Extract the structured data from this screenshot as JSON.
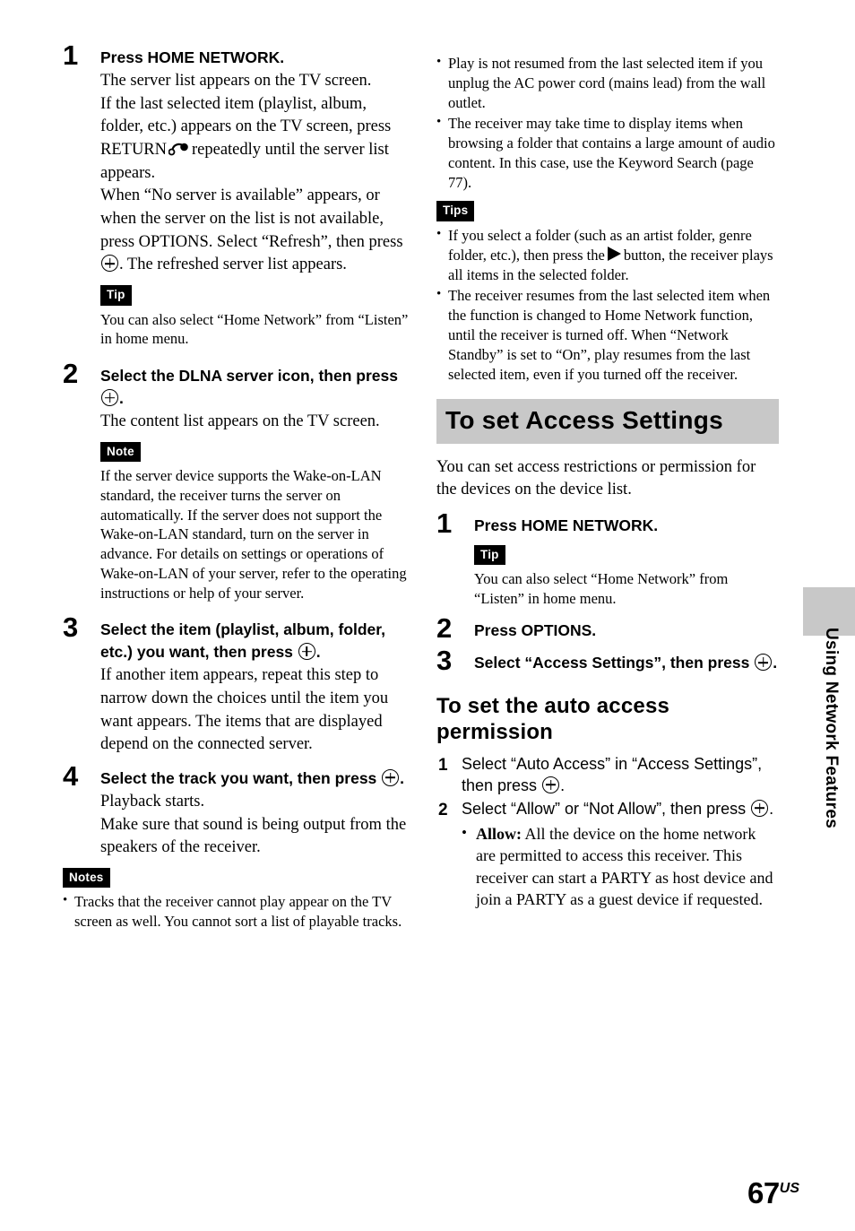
{
  "page": {
    "number": "67",
    "region_suffix": "US",
    "side_tab_label": "Using Network Features",
    "tab_color": "#c8c8c8"
  },
  "left_column": {
    "steps": [
      {
        "num": "1",
        "title": "Press HOME NETWORK.",
        "body_1": "The server list appears on the TV screen.",
        "body_2_a": "If the last selected item (playlist, album, folder, etc.) appears on the TV screen, press RETURN",
        "body_2_b": "repeatedly until the server list appears.",
        "body_3_a": "When “No server is available” appears, or when the server on the list is not available, press OPTIONS. Select “Refresh”, then press",
        "body_3_b": ". The refreshed server list appears."
      },
      {
        "num": "2",
        "title_a": "Select the DLNA server icon, then press",
        "title_b": ".",
        "body_1": "The content list appears on the TV screen."
      },
      {
        "num": "3",
        "title_a": "Select the item (playlist, album, folder, etc.) you want, then press",
        "title_b": ".",
        "body_1": "If another item appears, repeat this step to narrow down the choices until the item you want appears. The items that are displayed depend on the connected server."
      },
      {
        "num": "4",
        "title_a": "Select the track you want, then press",
        "title_b": ".",
        "body_1": "Playback starts.",
        "body_2": "Make sure that sound is being output from the speakers of the receiver."
      }
    ],
    "tip_tag": "Tip",
    "tip_text": "You can also select “Home Network” from “Listen” in home menu.",
    "note_tag": "Note",
    "note_text": "If the server device supports the Wake-on-LAN standard, the receiver turns the server on automatically. If the server does not support the Wake-on-LAN standard, turn on the server in advance. For details on settings or operations of Wake-on-LAN of your server, refer to the operating instructions or help of your server.",
    "notes_tag": "Notes",
    "notes_items": [
      "Tracks that the receiver cannot play appear on the TV screen as well. You cannot sort a list of playable tracks."
    ]
  },
  "right_column": {
    "top_notes": [
      "Play is not resumed from the last selected item if you unplug the AC power cord (mains lead) from the wall outlet.",
      "The receiver may take time to display items when browsing a folder that contains a large amount of audio content. In this case, use the Keyword Search (page 77)."
    ],
    "tips_tag": "Tips",
    "tips_items": [
      {
        "text_a": "If you select a folder (such as an artist folder, genre folder, etc.), then press the",
        "text_b": "button, the receiver plays all items in the selected folder."
      },
      {
        "text_a": "The receiver resumes from the last selected item when the function is changed to Home Network function, until the receiver is turned off. When “Network Standby” is set to “On”, play resumes from the last selected item, even if you turned off the receiver."
      }
    ],
    "section_heading": "To set Access Settings",
    "section_intro": "You can set access restrictions or permission for the devices on the device list.",
    "steps": [
      {
        "num": "1",
        "title": "Press HOME NETWORK."
      },
      {
        "num": "2",
        "title": "Press OPTIONS."
      },
      {
        "num": "3",
        "title_a": "Select “Access Settings”, then press",
        "title_b": "."
      }
    ],
    "tip_tag": "Tip",
    "tip_text": "You can also select “Home Network” from “Listen” in home menu.",
    "sub_heading": "To set the auto access permission",
    "substeps": [
      {
        "num": "1",
        "text_a": "Select “Auto Access” in “Access Settings”, then press",
        "text_b": "."
      },
      {
        "num": "2",
        "text_a": "Select “Allow” or “Not Allow”, then press",
        "text_b": "."
      }
    ],
    "substep_bullets": [
      {
        "label": "Allow:",
        "text": " All the device on the home network are permitted to access this receiver. This receiver can start a PARTY as host device and join a PARTY as a guest device if requested."
      }
    ]
  }
}
